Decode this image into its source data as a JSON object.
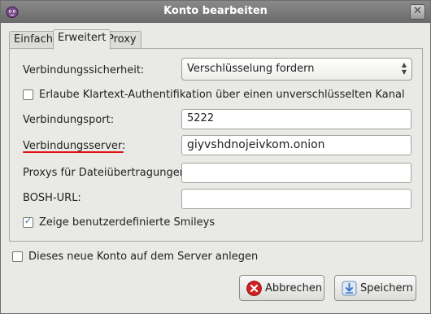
{
  "window": {
    "title": "Konto bearbeiten",
    "close_glyph": "✕",
    "accent": "#6b6b6b"
  },
  "tabs": [
    {
      "label": "Einfach",
      "active": false
    },
    {
      "label": "Erweitert",
      "active": true
    },
    {
      "label": "Proxy",
      "active": false
    }
  ],
  "form": {
    "security_label": "Verbindungssicherheit:",
    "security_value": "Verschlüsselung fordern",
    "plaintext_auth_label": "Erlaube Klartext-Authentifikation über einen unverschlüsselten Kanal",
    "plaintext_auth_checked": false,
    "port_label": "Verbindungsport:",
    "port_value": "5222",
    "server_label": "Verbindungsserver:",
    "server_value": "giyvshdnojeivkom.onion",
    "file_proxy_label": "Proxys für Dateiübertragungen:",
    "file_proxy_value": "",
    "bosh_label": "BOSH-URL:",
    "bosh_value": "",
    "smileys_label": "Zeige benutzerdefinierte Smileys",
    "smileys_checked": true
  },
  "register": {
    "label": "Dieses neue Konto auf dem Server anlegen",
    "checked": false
  },
  "buttons": {
    "cancel_label": "Abbrechen",
    "cancel_icon": "cancel-icon",
    "save_label": "Speichern",
    "save_icon": "save-icon"
  },
  "colors": {
    "annotation_underline": "#e01010",
    "cancel_icon": "#d02020",
    "save_icon": "#3a78c8"
  }
}
